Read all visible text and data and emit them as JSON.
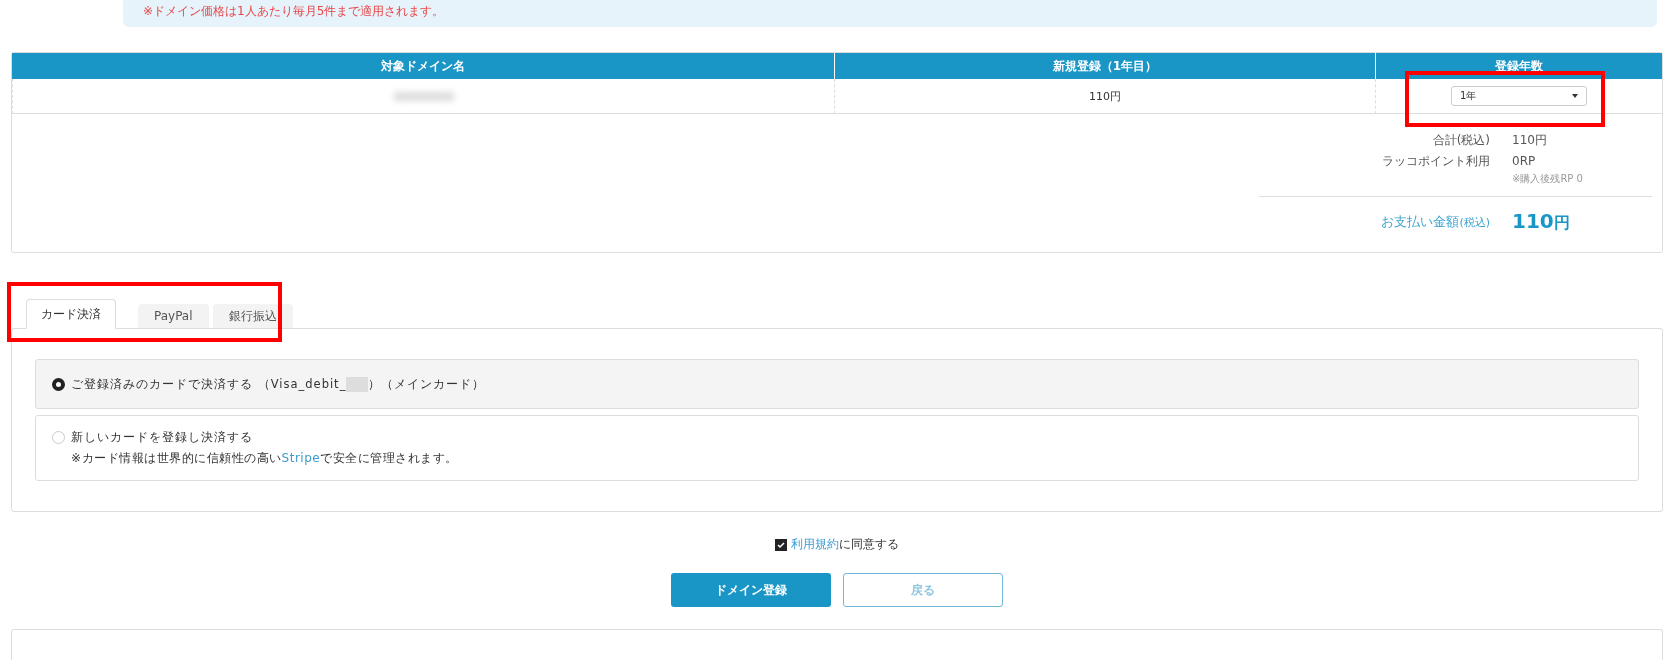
{
  "notice": {
    "text": "※ドメイン価格は1人あたり毎月5件まで適用されます。"
  },
  "table": {
    "columns": [
      "対象ドメイン名",
      "新規登録（1年目）",
      "登録年数"
    ],
    "rows": [
      {
        "domain_blurred": true,
        "price": "110円",
        "years": "1年",
        "highlighted": true
      }
    ]
  },
  "summary": {
    "lines": [
      {
        "label": "合計(税込)",
        "value": "110円"
      },
      {
        "label": "ラッコポイント利用",
        "value": "0RP",
        "note": "※購入後残RP 0"
      }
    ],
    "total_label": "お支払い金額",
    "total_suffix": "(税込)",
    "total_value": "110",
    "total_unit": "円"
  },
  "tabs_highlighted": true,
  "tabs": [
    {
      "label": "カード決済",
      "selected": true
    },
    {
      "label": "PayPal",
      "selected": false
    },
    {
      "label": "銀行振込",
      "selected": false
    }
  ],
  "payment_options": [
    {
      "label": "ご登録済みのカードで決済する （Visa_debit_",
      "masked": true,
      "label_after": "）（メインカード）",
      "selected": true
    },
    {
      "label": "新しいカードを登録し決済する",
      "note_before": "※カード情報は世界的に信頼性の高い",
      "note_link": "Stripe",
      "note_after": "で安全に管理されます。",
      "selected": false
    }
  ],
  "agreement": {
    "checked": true,
    "link": "利用規約",
    "text": "に同意する"
  },
  "buttons": [
    {
      "label": "ドメイン登録",
      "kind": "primary"
    },
    {
      "label": "戻る",
      "kind": "secondary"
    }
  ]
}
